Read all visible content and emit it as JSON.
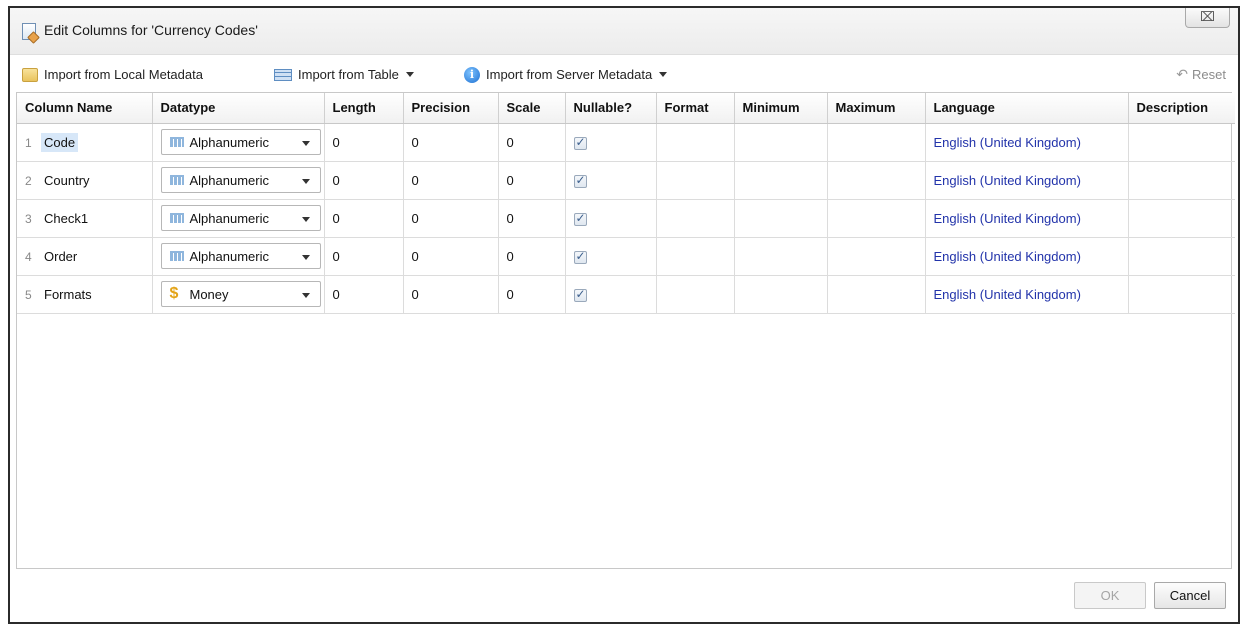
{
  "window": {
    "title": "Edit Columns for 'Currency Codes'",
    "close_glyph": "⌧"
  },
  "toolbar": {
    "import_local": "Import from Local Metadata",
    "import_table": "Import from Table",
    "import_server": "Import from Server Metadata",
    "reset": "Reset"
  },
  "grid": {
    "headers": [
      "Column Name",
      "Datatype",
      "Length",
      "Precision",
      "Scale",
      "Nullable?",
      "Format",
      "Minimum",
      "Maximum",
      "Language",
      "Description"
    ],
    "rows": [
      {
        "num": "1",
        "name": "Code",
        "datatype": "Alphanumeric",
        "datatype_icon": "alphanumeric-icon",
        "length": "0",
        "precision": "0",
        "scale": "0",
        "nullable": true,
        "format": "",
        "minimum": "",
        "maximum": "",
        "language": "English (United Kingdom)",
        "description": ""
      },
      {
        "num": "2",
        "name": "Country",
        "datatype": "Alphanumeric",
        "datatype_icon": "alphanumeric-icon",
        "length": "0",
        "precision": "0",
        "scale": "0",
        "nullable": true,
        "format": "",
        "minimum": "",
        "maximum": "",
        "language": "English (United Kingdom)",
        "description": ""
      },
      {
        "num": "3",
        "name": "Check1",
        "datatype": "Alphanumeric",
        "datatype_icon": "alphanumeric-icon",
        "length": "0",
        "precision": "0",
        "scale": "0",
        "nullable": true,
        "format": "",
        "minimum": "",
        "maximum": "",
        "language": "English (United Kingdom)",
        "description": ""
      },
      {
        "num": "4",
        "name": "Order",
        "datatype": "Alphanumeric",
        "datatype_icon": "alphanumeric-icon",
        "length": "0",
        "precision": "0",
        "scale": "0",
        "nullable": true,
        "format": "",
        "minimum": "",
        "maximum": "",
        "language": "English (United Kingdom)",
        "description": ""
      },
      {
        "num": "5",
        "name": "Formats",
        "datatype": "Money",
        "datatype_icon": "money-icon",
        "length": "0",
        "precision": "0",
        "scale": "0",
        "nullable": true,
        "format": "",
        "minimum": "",
        "maximum": "",
        "language": "English (United Kingdom)",
        "description": ""
      }
    ]
  },
  "footer": {
    "ok": "OK",
    "cancel": "Cancel"
  },
  "colors": {
    "link": "#2233aa",
    "selection": "#d7e7f8",
    "disabled_text": "#a5a5a5"
  }
}
